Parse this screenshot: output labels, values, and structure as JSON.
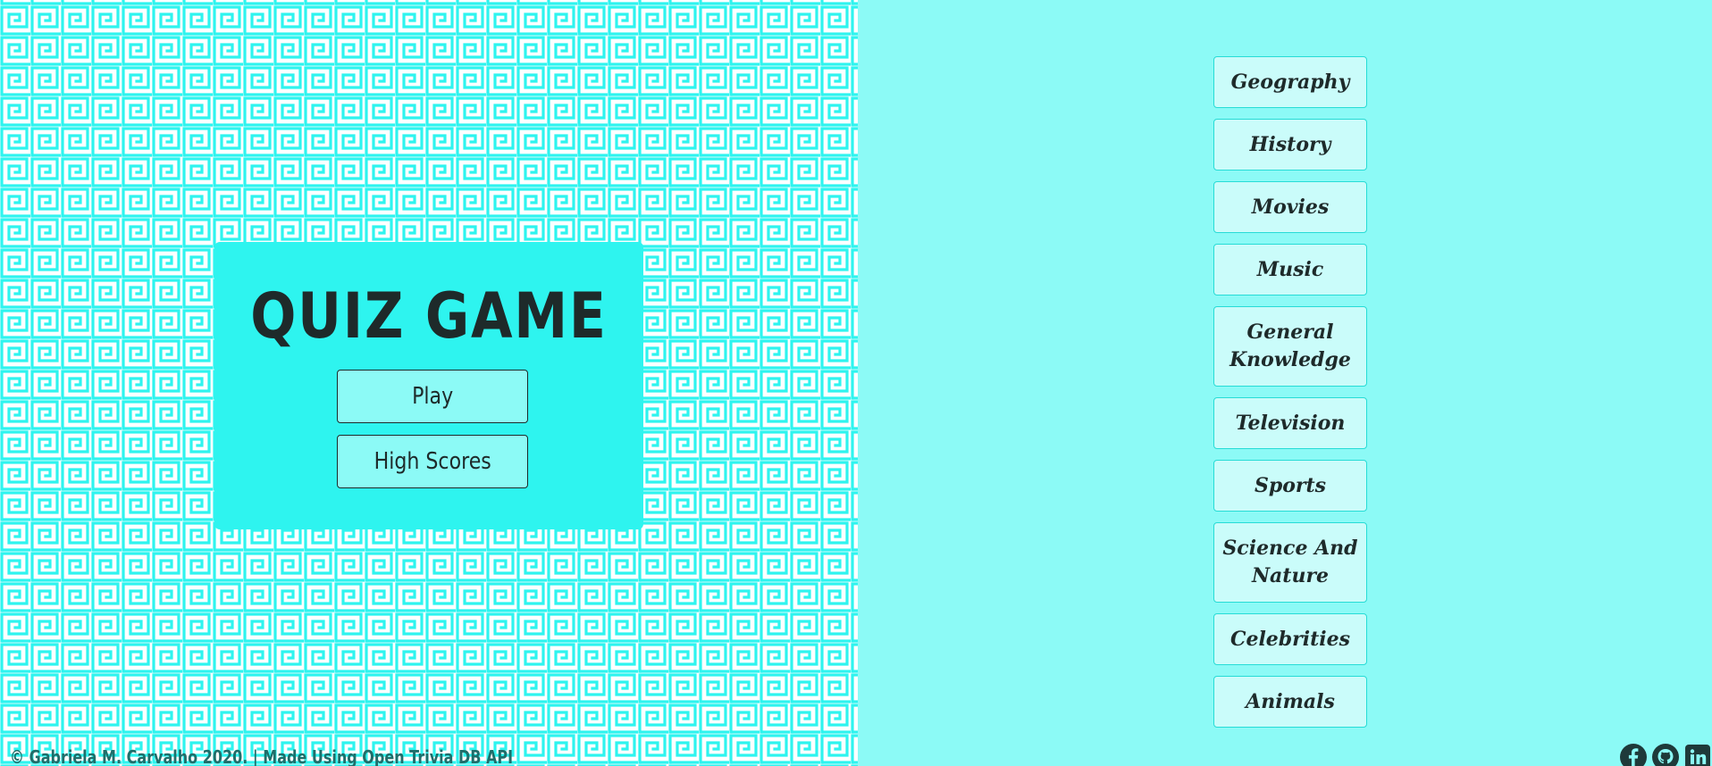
{
  "menu": {
    "title": "QUIZ GAME",
    "play_label": "Play",
    "high_scores_label": "High Scores"
  },
  "categories": [
    {
      "label": "Geography"
    },
    {
      "label": "History"
    },
    {
      "label": "Movies"
    },
    {
      "label": "Music"
    },
    {
      "label": "General Knowledge"
    },
    {
      "label": "Television"
    },
    {
      "label": "Sports"
    },
    {
      "label": "Science And Nature"
    },
    {
      "label": "Celebrities"
    },
    {
      "label": "Animals"
    }
  ],
  "footer": {
    "credit": "© Gabriela M. Carvalho 2020. | Made Using Open Trivia DB API"
  },
  "social": [
    {
      "icon": "facebook-icon"
    },
    {
      "icon": "github-icon"
    },
    {
      "icon": "linkedin-icon"
    }
  ],
  "colors": {
    "pattern_line": "#2ef4ef",
    "pattern_bg": "#ffffff",
    "right_bg": "#8cfaf6",
    "card_bg": "#2ef4ef",
    "category_bg": "#cafcfa",
    "category_border": "#26dcd6",
    "text_dark": "#1e2a2a",
    "footer_text": "#1f6e6a"
  }
}
